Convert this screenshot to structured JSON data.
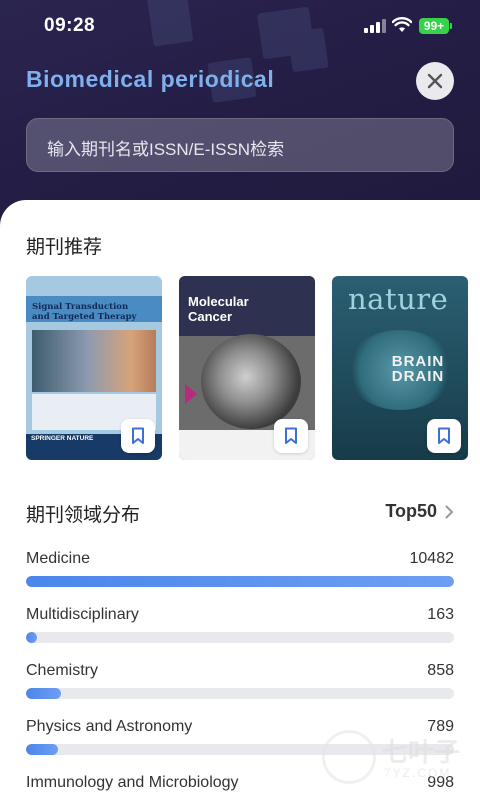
{
  "status_bar": {
    "time": "09:28",
    "battery": "99+"
  },
  "header": {
    "title": "Biomedical periodical",
    "search_placeholder": "输入期刊名或ISSN/E-ISSN检索"
  },
  "recommend": {
    "title": "期刊推荐",
    "covers": [
      {
        "title": "Signal Transduction and Targeted Therapy",
        "publisher": "SPRINGER NATURE"
      },
      {
        "title": "Molecular Cancer"
      },
      {
        "title": "nature",
        "headline": "BRAIN DRAIN"
      }
    ]
  },
  "distribution": {
    "title": "期刊领域分布",
    "top_link": "Top50",
    "max_value": 10482,
    "items": [
      {
        "label": "Medicine",
        "count": "10482",
        "value": 10482
      },
      {
        "label": "Multidisciplinary",
        "count": "163",
        "value": 163
      },
      {
        "label": "Chemistry",
        "count": "858",
        "value": 858
      },
      {
        "label": "Physics and Astronomy",
        "count": "789",
        "value": 789
      },
      {
        "label": "Immunology and Microbiology",
        "count": "998",
        "value": 998
      }
    ]
  },
  "watermark": {
    "text": "七叶子",
    "sub": "7YZ.COM"
  },
  "colors": {
    "accent": "#4b86ea",
    "header_bg": "#241e46",
    "title": "#7fb0ee",
    "battery": "#35d24a"
  }
}
